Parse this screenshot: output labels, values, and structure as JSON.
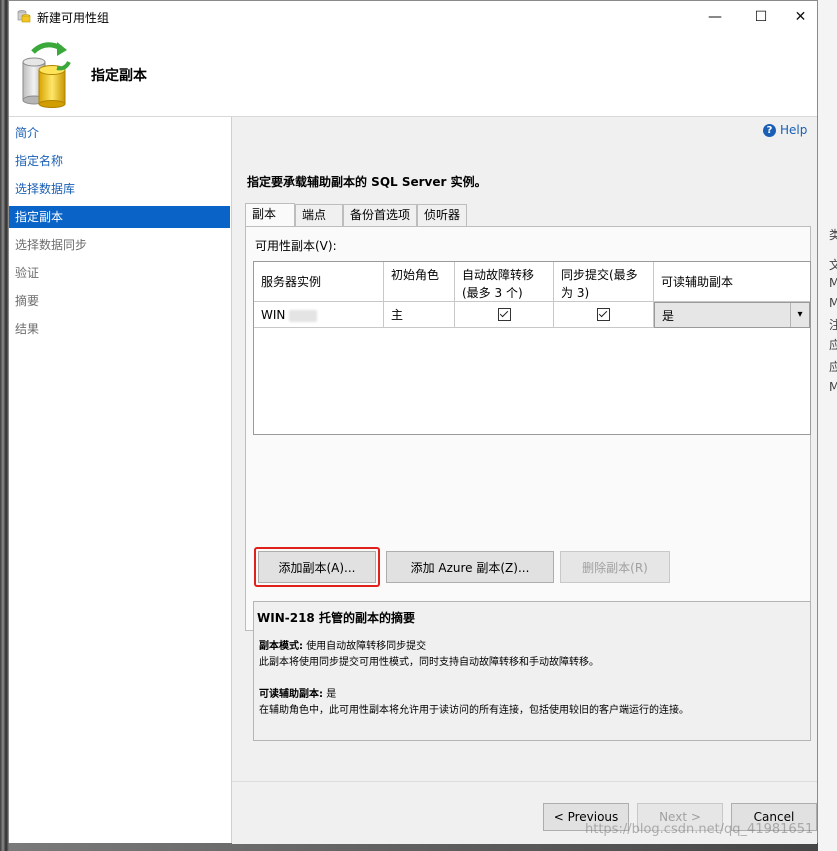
{
  "window": {
    "title": "新建可用性组",
    "controls": [
      "—",
      "☐",
      "✕"
    ]
  },
  "header": {
    "title": "指定副本"
  },
  "sidebar": {
    "items": [
      {
        "label": "简介",
        "state": "link"
      },
      {
        "label": "指定名称",
        "state": "link"
      },
      {
        "label": "选择数据库",
        "state": "link"
      },
      {
        "label": "指定副本",
        "state": "selected"
      },
      {
        "label": "选择数据同步",
        "state": "disabled"
      },
      {
        "label": "验证",
        "state": "disabled"
      },
      {
        "label": "摘要",
        "state": "disabled"
      },
      {
        "label": "结果",
        "state": "disabled"
      }
    ]
  },
  "help": {
    "label": "Help"
  },
  "instruction": "指定要承载辅助副本的 SQL Server 实例。",
  "tabs": [
    "副本",
    "端点",
    "备份首选项",
    "侦听器"
  ],
  "grid": {
    "label": "可用性副本(V):",
    "headers": [
      "服务器实例",
      "初始角色",
      "自动故障转移(最多 3 个)",
      "同步提交(最多为 3)",
      "可读辅助副本"
    ],
    "rows": [
      {
        "server": "WIN",
        "role": "主",
        "auto_failover": true,
        "sync_commit": true,
        "readable": "是"
      }
    ]
  },
  "buttons": {
    "add_replica": "添加副本(A)...",
    "add_azure_replica": "添加 Azure 副本(Z)...",
    "remove_replica": "删除副本(R)"
  },
  "summary": {
    "title": "WIN-218 托管的副本的摘要",
    "mode_label": "副本模式:",
    "mode_value": "使用自动故障转移同步提交",
    "mode_desc": "此副本将使用同步提交可用性模式，同时支持自动故障转移和手动故障转移。",
    "readable_label": "可读辅助副本:",
    "readable_value": "是",
    "readable_desc": "在辅助角色中，此可用性副本将允许用于读访问的所有连接，包括使用较旧的客户端运行的连接。"
  },
  "footer": {
    "previous": "< Previous",
    "next": "Next >",
    "cancel": "Cancel"
  },
  "background_text": [
    "类",
    "文",
    "M",
    "M",
    "注",
    "应",
    "应",
    "M"
  ],
  "watermark": "https://blog.csdn.net/qq_41981651"
}
